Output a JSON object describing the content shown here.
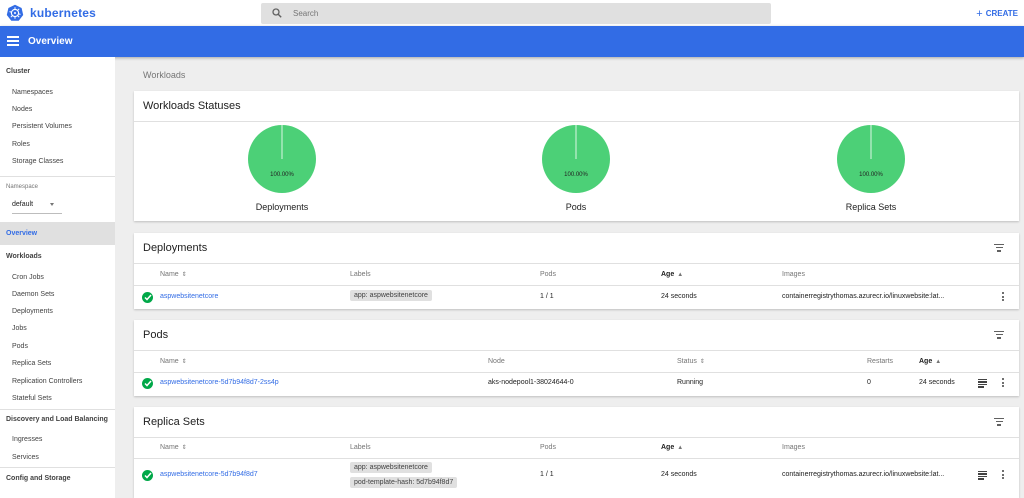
{
  "app": {
    "brand": "kubernetes",
    "search_placeholder": "Search",
    "create_label": "CREATE",
    "page_title": "Overview",
    "brand_color": "#326ce5"
  },
  "sidebar": {
    "cluster_title": "Cluster",
    "cluster_items": [
      "Namespaces",
      "Nodes",
      "Persistent Volumes",
      "Roles",
      "Storage Classes"
    ],
    "namespace_label": "Namespace",
    "namespace_value": "default",
    "overview_label": "Overview",
    "workloads_title": "Workloads",
    "workloads_items": [
      "Cron Jobs",
      "Daemon Sets",
      "Deployments",
      "Jobs",
      "Pods",
      "Replica Sets",
      "Replication Controllers",
      "Stateful Sets"
    ],
    "discovery_title": "Discovery and Load Balancing",
    "discovery_items": [
      "Ingresses",
      "Services"
    ],
    "config_title": "Config and Storage"
  },
  "breadcrumb": "Workloads",
  "statuses": {
    "title": "Workloads Statuses",
    "charts": [
      {
        "label": "Deployments",
        "percent": "100.00%",
        "running_fraction": 1.0,
        "color": "#4cd077"
      },
      {
        "label": "Pods",
        "percent": "100.00%",
        "running_fraction": 1.0,
        "color": "#4cd077"
      },
      {
        "label": "Replica Sets",
        "percent": "100.00%",
        "running_fraction": 1.0,
        "color": "#4cd077"
      }
    ]
  },
  "deployments": {
    "title": "Deployments",
    "headers": {
      "name": "Name",
      "labels": "Labels",
      "pods": "Pods",
      "age": "Age",
      "images": "Images"
    },
    "rows": [
      {
        "name": "aspwebsitenetcore",
        "label": "app: aspwebsitenetcore",
        "pods": "1 / 1",
        "age": "24 seconds",
        "images": "containerregistrythomas.azurecr.io/linuxwebsite:lat..."
      }
    ]
  },
  "pods": {
    "title": "Pods",
    "headers": {
      "name": "Name",
      "node": "Node",
      "status": "Status",
      "restarts": "Restarts",
      "age": "Age"
    },
    "rows": [
      {
        "name": "aspwebsitenetcore-5d7b94f8d7-2ss4p",
        "node": "aks-nodepool1-38024644-0",
        "status": "Running",
        "restarts": "0",
        "age": "24 seconds"
      }
    ]
  },
  "replica_sets": {
    "title": "Replica Sets",
    "headers": {
      "name": "Name",
      "labels": "Labels",
      "pods": "Pods",
      "age": "Age",
      "images": "Images"
    },
    "rows": [
      {
        "name": "aspwebsitenetcore-5d7b94f8d7",
        "label1": "app: aspwebsitenetcore",
        "label2": "pod-template-hash: 5d7b94f8d7",
        "pods": "1 / 1",
        "age": "24 seconds",
        "images": "containerregistrythomas.azurecr.io/linuxwebsite:lat..."
      }
    ]
  },
  "colors": {
    "success": "#00a848",
    "header_bg": "#326ce5"
  }
}
